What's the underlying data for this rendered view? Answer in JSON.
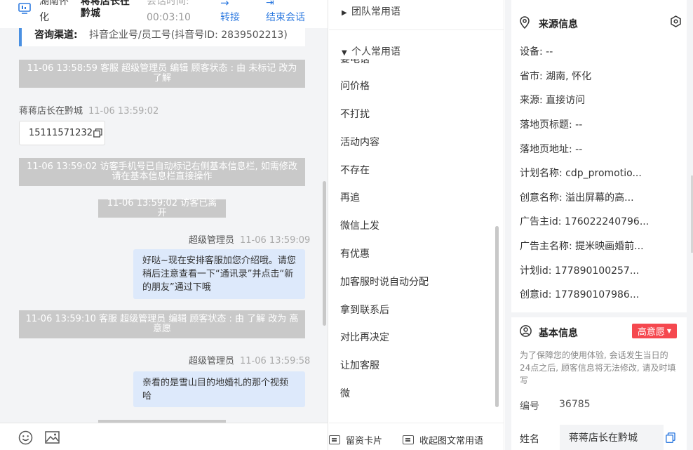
{
  "chat": {
    "header": {
      "location_line1": "湖南怀",
      "location_line2": "化",
      "customer_line1": "蒋蒋店长在",
      "customer_line2": "黔城",
      "duration_label": "会话时间:",
      "duration_value": "00:03:10",
      "transfer_label": "转接",
      "end_label": "结束会话"
    },
    "channel": {
      "label": "咨询渠道:",
      "value": "抖音企业号/员工号(抖音号ID: 2839502213)"
    },
    "messages": [
      {
        "type": "system",
        "text": "11-06 13:58:59 客服 超级管理员 编辑 顾客状态 : 由 未标记 改为 了解"
      },
      {
        "type": "sender",
        "name": "蒋蒋店长在黔城",
        "time": "11-06 13:59:02"
      },
      {
        "type": "card",
        "text": "15111571232"
      },
      {
        "type": "system",
        "text": "11-06 13:59:02 访客手机号已自动标记右侧基本信息栏, 如需修改请在基本信息栏直接操作"
      },
      {
        "type": "system",
        "text": "11-06 13:59:02 访客已离开"
      },
      {
        "type": "sender",
        "name": "超级管理员",
        "time": "11-06 13:59:09"
      },
      {
        "type": "bubble",
        "text": "好哒~现在安排客服加您介绍哦。请您稍后注意查看一下“通讯录”并点击“新的朋友”通过下哦"
      },
      {
        "type": "system",
        "text": "11-06 13:59:10 客服 超级管理员 编辑 顾客状态 : 由 了解 改为 高意愿"
      },
      {
        "type": "sender",
        "name": "超级管理员",
        "time": "11-06 13:59:58"
      },
      {
        "type": "bubble",
        "text": "亲看的是雪山目的地婚礼的那个视频哈"
      }
    ]
  },
  "phrases": {
    "team_group": "团队常用语",
    "personal_group": "个人常用语",
    "clipped_item": "要电话",
    "items": [
      "问价格",
      "不打扰",
      "活动内容",
      "不存在",
      "再追",
      "微信上发",
      "有优惠",
      "加客服时说自动分配",
      "拿到联系后",
      "对比再决定",
      "让加客服",
      "微"
    ],
    "bottom": {
      "leave_card": "留资卡片",
      "collapse": "收起图文常用语"
    }
  },
  "info": {
    "source_title": "来源信息",
    "source_rows": [
      {
        "label": "设备:",
        "value": "--"
      },
      {
        "label": "省市:",
        "value": "湖南, 怀化"
      },
      {
        "label": "来源:",
        "value": "直接访问"
      },
      {
        "label": "落地页标题:",
        "value": "--"
      },
      {
        "label": "落地页地址:",
        "value": "--"
      },
      {
        "label": "计划名称:",
        "value": "cdp_promotio..."
      },
      {
        "label": "创意名称:",
        "value": "溢出屏幕的高..."
      },
      {
        "label": "广告主id:",
        "value": "176022240796..."
      },
      {
        "label": "广告主名称:",
        "value": "提米映画婚前..."
      },
      {
        "label": "计划id:",
        "value": "177890100257..."
      },
      {
        "label": "创意id:",
        "value": "177890107986..."
      }
    ],
    "basic_title": "基本信息",
    "intent_badge": "高意愿",
    "note": "为了保障您的使用体验, 会话发生当日的24点之后, 顾客信息将无法修改, 请及时填写",
    "id_label": "编号",
    "id_value": "36785",
    "name_label": "姓名",
    "name_value": "蒋蒋店长在黔城"
  },
  "colors": {
    "accent": "#2f7be0",
    "bubble": "#dde9fb",
    "system": "#c9c9c9",
    "badge": "#f5484f"
  }
}
